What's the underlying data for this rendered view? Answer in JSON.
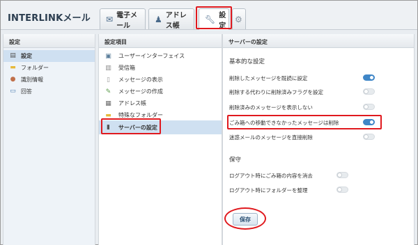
{
  "app": {
    "title": "INTERLINKメール"
  },
  "tabs": [
    {
      "label": "電子メール",
      "icon": "mail-icon"
    },
    {
      "label": "アドレス帳",
      "icon": "address-book-icon"
    },
    {
      "label": "設定",
      "icon": "wrench-icon"
    },
    {
      "label": "",
      "icon": "gear-icon"
    }
  ],
  "left_panel": {
    "title": "設定",
    "items": [
      {
        "label": "設定",
        "icon": "settings-icon",
        "selected": true
      },
      {
        "label": "フォルダー",
        "icon": "folder-icon"
      },
      {
        "label": "識別情報",
        "icon": "person-icon"
      },
      {
        "label": "回答",
        "icon": "document-icon"
      }
    ]
  },
  "middle_panel": {
    "title": "設定項目",
    "items": [
      {
        "label": "ユーザーインターフェイス",
        "icon": "monitor-icon"
      },
      {
        "label": "受信箱",
        "icon": "inbox-icon"
      },
      {
        "label": "メッセージの表示",
        "icon": "page-icon"
      },
      {
        "label": "メッセージの作成",
        "icon": "compose-icon"
      },
      {
        "label": "アドレス帳",
        "icon": "contacts-icon"
      },
      {
        "label": "特殊なフォルダー",
        "icon": "folder-icon"
      },
      {
        "label": "サーバーの設定",
        "icon": "server-icon",
        "selected": true
      }
    ]
  },
  "right_panel": {
    "title": "サーバーの設定",
    "basic": {
      "title": "基本的な設定",
      "rows": [
        {
          "label": "削除したメッセージを既読に設定",
          "on": true
        },
        {
          "label": "削除する代わりに削除済みフラグを設定",
          "on": false
        },
        {
          "label": "削除済みのメッセージを表示しない",
          "on": false
        },
        {
          "label": "ごみ箱への移動できなかったメッセージは削除",
          "on": true
        },
        {
          "label": "迷惑メールのメッセージを直接削除",
          "on": false
        }
      ]
    },
    "maintenance": {
      "title": "保守",
      "rows": [
        {
          "label": "ログアウト時にごみ箱の内容を消去",
          "on": false
        },
        {
          "label": "ログアウト時にフォルダーを整理",
          "on": false
        }
      ]
    },
    "save_label": "保存"
  },
  "colors": {
    "highlight": "#e0191e",
    "toggle_on": "#3f86c7",
    "selected_bg": "#cfe0f1"
  }
}
